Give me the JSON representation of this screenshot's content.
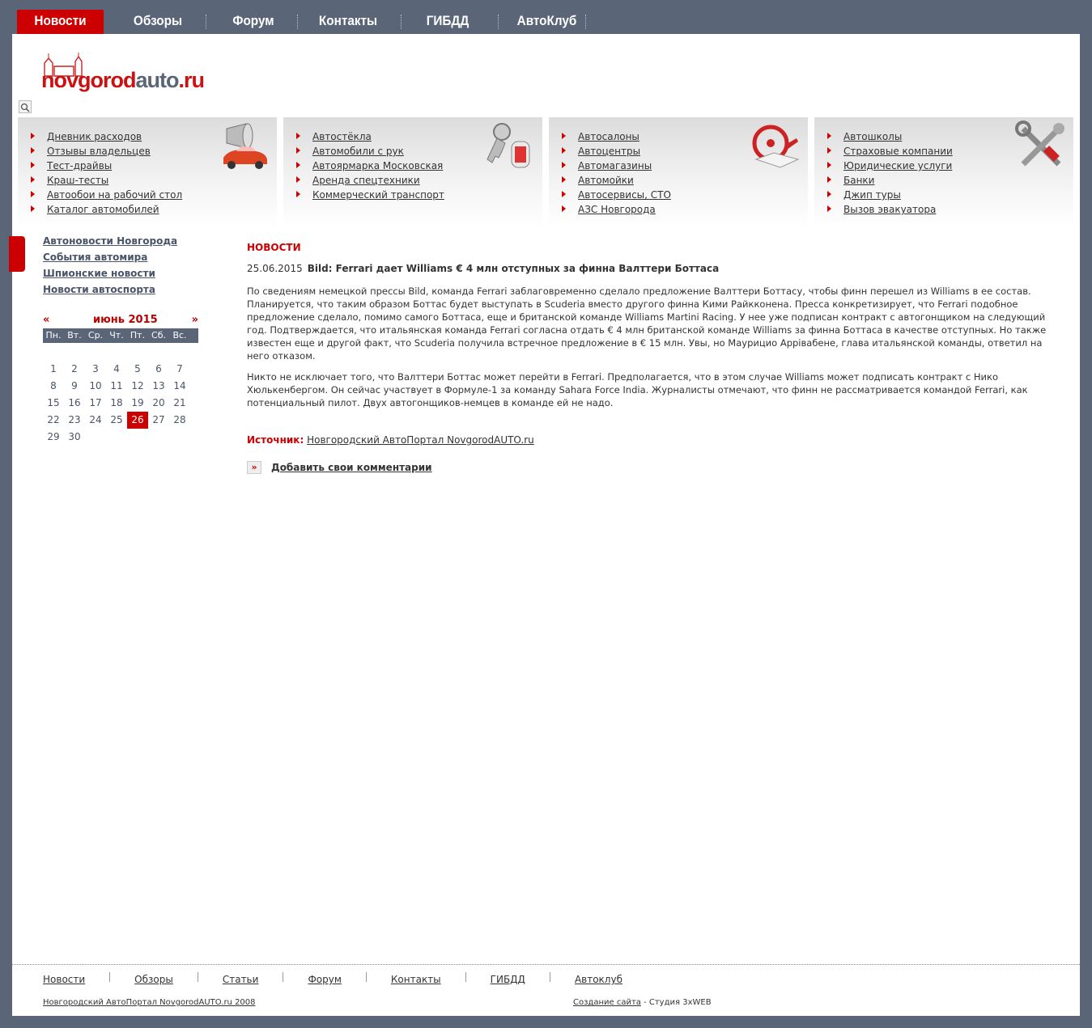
{
  "topnav": [
    "Новости",
    "Обзоры",
    "Форум",
    "Контакты",
    "ГИБДД",
    "АвтоКлуб"
  ],
  "logo": {
    "part1": "novgorod",
    "part2": "auto",
    "part3": ".ru"
  },
  "categories": [
    {
      "icon": "car-horn-icon",
      "items": [
        "Дневник расходов",
        "Отзывы владельцев",
        "Тест-драйвы",
        "Краш-тесты",
        "Автообои на рабочий стол",
        "Каталог автомобилей"
      ]
    },
    {
      "icon": "car-key-icon",
      "items": [
        "Автостёкла",
        "Автомобили с рук",
        "Автоярмарка Московская",
        "Аренда спецтехники",
        "Коммерческий транспорт"
      ]
    },
    {
      "icon": "steering-wheel-book-icon",
      "items": [
        "Автосалоны",
        "Автоцентры",
        "Автомагазины",
        "Автомойки",
        "Автосервисы, СТО",
        "АЗС Новгорода"
      ]
    },
    {
      "icon": "tools-icon",
      "items": [
        "Автошколы",
        "Страховые компании",
        "Юридические услуги",
        "Банки",
        "Джип туры",
        "Вызов эвакуатора"
      ]
    }
  ],
  "sidebar": {
    "links": [
      "Автоновости Новгорода",
      "События автомира",
      "Шпионские новости",
      "Новости автоспорта"
    ]
  },
  "calendar": {
    "prev": "«",
    "next": "»",
    "month": "июнь 2015",
    "weekdays": [
      "Пн.",
      "Вт.",
      "Ср.",
      "Чт.",
      "Пт.",
      "Сб.",
      "Вс."
    ],
    "weeks": [
      [
        "1",
        "2",
        "3",
        "4",
        "5",
        "6",
        "7"
      ],
      [
        "8",
        "9",
        "10",
        "11",
        "12",
        "13",
        "14"
      ],
      [
        "15",
        "16",
        "17",
        "18",
        "19",
        "20",
        "21"
      ],
      [
        "22",
        "23",
        "24",
        "25",
        "26",
        "27",
        "28"
      ],
      [
        "29",
        "30",
        "",
        "",
        "",
        "",
        ""
      ]
    ],
    "today": "26"
  },
  "article": {
    "section": "НОВОСТИ",
    "date": "25.06.2015",
    "title": "Bild: Ferrari дает Williams € 4 млн отступных за финна Валттери Боттаса",
    "paragraphs": [
      "По сведениям немецкой прессы Bild, команда Ferrari заблаговременно сделало предложение Валттери Боттасу, чтобы финн перешел из Williams в ее состав. Планируется, что таким образом Боттас будет выступать в Scuderia вместо другого финна Кими Райкконена. Пресса конкретизирует, что Ferrari подобное предложение сделало, помимо самого Боттаса, еще и британской команде Williams Martini Racing. У нее уже подписан контракт с автогонщиком на следующий год. Подтверждается, что итальянская команда Ferrari согласна отдать € 4 млн британской команде Williams за финна Боттаса в качестве отступных. Но также известен еще и другой факт, что Scuderia получила встречное предложение в € 15 млн. Увы, но Маурицио Аррівабене, глава итальянской команды, ответил на него отказом.",
      "Никто не исключает того, что Валттери Боттас может перейти в Ferrari. Предполагается, что в этом случае Williams может подписать контракт с Нико Хюлькенбергом. Он сейчас участвует в Формуле-1 за команду Sahara Force India. Журналисты отмечают, что финн не рассматривается командой Ferrari, как потенциальный пилот. Двух автогонщиков-немцев в команде ей не надо."
    ],
    "source_label": "Источник:",
    "source_link": "Новгородский АвтоПортал NovgorodAUTO.ru",
    "add_comment_icon": "»",
    "add_comment": "Добавить свои комментарии"
  },
  "footer": {
    "links": [
      "Новости",
      "Обзоры",
      "Статьи",
      "Форум",
      "Контакты",
      "ГИБДД",
      "Автоклуб"
    ],
    "copyright": "Новгородский АвтоПортал NovgorodAUTO.ru 2008",
    "credit_link": "Создание сайта",
    "credit_text": " - Студия 3xWEB"
  },
  "colors": {
    "accent": "#cc0000",
    "frame": "#5a6578",
    "link_dark": "#4a5468"
  }
}
